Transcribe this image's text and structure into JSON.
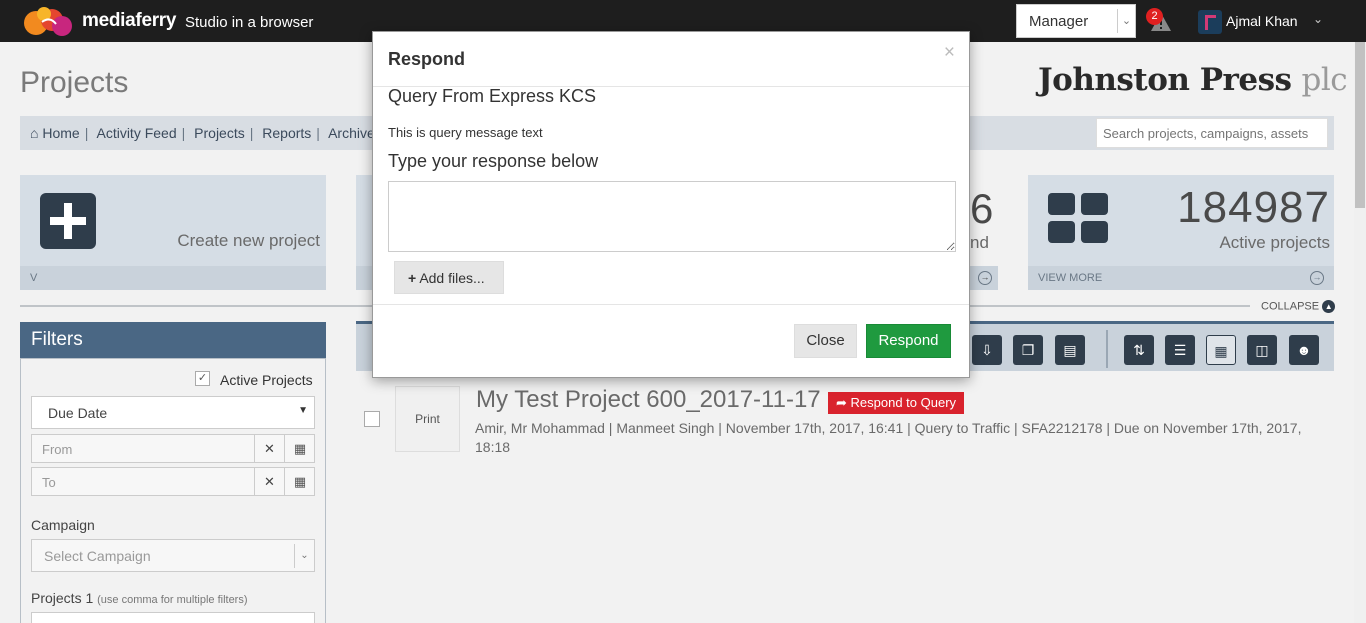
{
  "topbar": {
    "brand": "mediaferry",
    "tagline": "Studio in a browser",
    "role": "Manager",
    "alert_count": "2",
    "user_name": "Ajmal Khan"
  },
  "page": {
    "title": "Projects",
    "client_logo_main": "Johnston Press",
    "client_logo_suffix": "plc",
    "breadcrumb": [
      "Home",
      "Activity Feed",
      "Projects",
      "Reports",
      "Archive"
    ],
    "search_placeholder": "Search projects, campaigns, assets",
    "collapse_label": "COLLAPSE"
  },
  "cards": {
    "create_label": "Create new project",
    "partial_number": "6",
    "partial_label": "nd",
    "active_number": "184987",
    "active_label": "Active projects",
    "view_more": "VIEW MORE"
  },
  "filters": {
    "title": "Filters",
    "active_projects_label": "Active Projects",
    "active_projects_checked": true,
    "sort_by": "Due Date",
    "from_placeholder": "From",
    "to_placeholder": "To",
    "campaign_label": "Campaign",
    "campaign_placeholder": "Select Campaign",
    "projects_label": "Projects 1",
    "projects_hint": "(use comma for multiple filters)"
  },
  "project": {
    "thumb_label": "Print",
    "title": "My Test Project 600_2017-11-17",
    "tag": "Respond to Query",
    "meta": "Amir, Mr Mohammad | Manmeet Singh | November 17th, 2017, 16:41 | Query to Traffic | SFA2212178 | Due on November 17th, 2017, 18:18"
  },
  "modal": {
    "title": "Respond",
    "close_x": "×",
    "query_from": "Query From Express KCS",
    "query_message": "This is query message text",
    "response_heading": "Type your response below",
    "response_value": "",
    "add_files": "Add files...",
    "close_button": "Close",
    "respond_button": "Respond"
  },
  "colors": {
    "topbar": "#1e1e1e",
    "accent_blue": "#4a6784",
    "respond_green": "#1f9a3f",
    "tag_red": "#d9232d"
  }
}
